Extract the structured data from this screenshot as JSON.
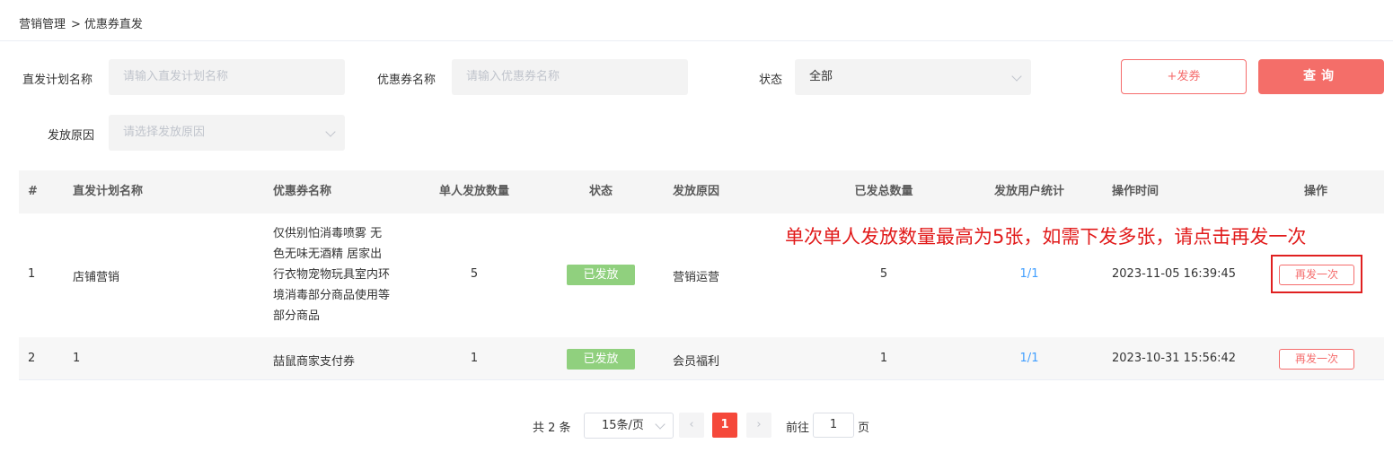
{
  "breadcrumb": {
    "root": "营销管理",
    "sep": ">",
    "current": "优惠券直发"
  },
  "filters": {
    "plan_name": {
      "label": "直发计划名称",
      "placeholder": "请输入直发计划名称"
    },
    "coupon_name": {
      "label": "优惠券名称",
      "placeholder": "请输入优惠券名称"
    },
    "status": {
      "label": "状态",
      "value": "全部"
    },
    "reason": {
      "label": "发放原因",
      "placeholder": "请选择发放原因"
    }
  },
  "actions": {
    "issue": "+发券",
    "query": "查询"
  },
  "table": {
    "headers": [
      "#",
      "直发计划名称",
      "优惠券名称",
      "单人发放数量",
      "状态",
      "发放原因",
      "已发总数量",
      "发放用户统计",
      "操作时间",
      "操作"
    ],
    "rows": [
      {
        "idx": "1",
        "plan": "店铺营销",
        "coupon_lines": [
          "仅供别怕消毒喷雾 无",
          "色无味无酒精 居家出",
          "行衣物宠物玩具室内环",
          "境消毒部分商品使用等",
          "部分商品"
        ],
        "qty": "5",
        "status": "已发放",
        "reason": "营销运营",
        "total": "5",
        "stats": "1/1",
        "time": "2023-11-05 16:39:45",
        "op": "再发一次"
      },
      {
        "idx": "2",
        "plan": "1",
        "coupon": "喆鼠商家支付券",
        "qty": "1",
        "status": "已发放",
        "reason": "会员福利",
        "total": "1",
        "stats": "1/1",
        "time": "2023-10-31 15:56:42",
        "op": "再发一次"
      }
    ]
  },
  "annotation": "单次单人发放数量最高为5张，如需下发多张，请点击再发一次",
  "pagination": {
    "total_text": "共 2 条",
    "page_size": "15条/页",
    "current_page": "1",
    "goto_label": "前往",
    "goto_value": "1",
    "page_unit": "页"
  },
  "colors": {
    "accent": "#f46e69",
    "status_badge": "#90d07e",
    "link": "#409eff",
    "annotation": "#e11a1a"
  }
}
